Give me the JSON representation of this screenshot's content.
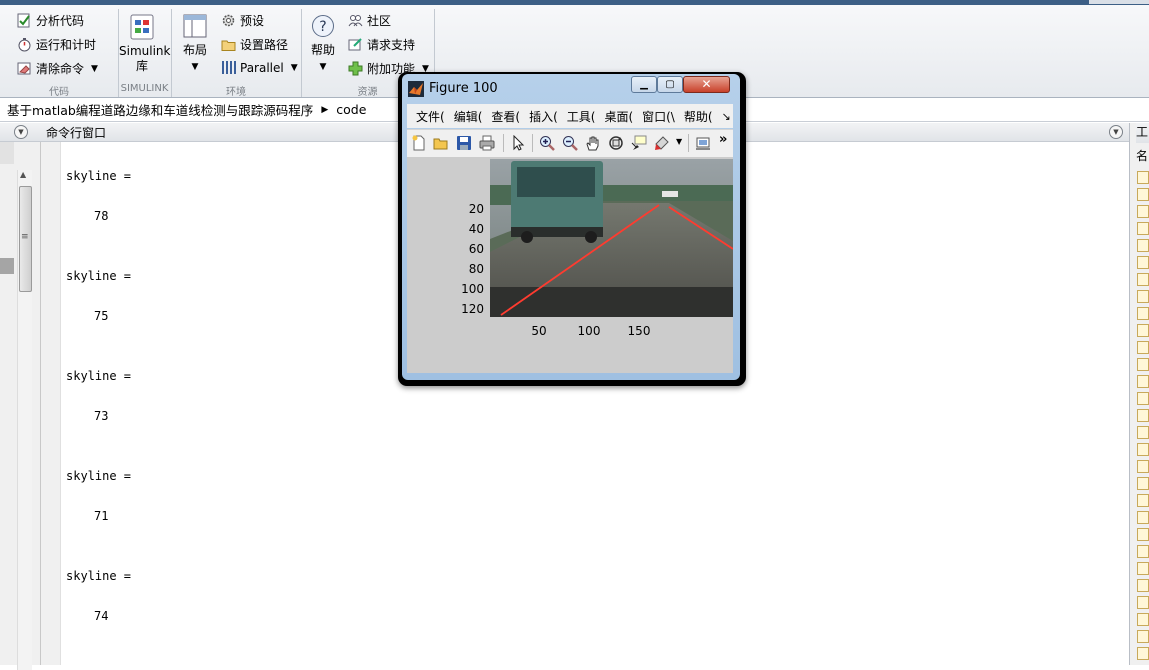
{
  "ribbon": {
    "code_group": {
      "items": [
        "分析代码",
        "运行和计时",
        "清除命令"
      ],
      "label": "代码"
    },
    "simulink_group": {
      "button": [
        "Simulink",
        "库"
      ],
      "label": "SIMULINK"
    },
    "env_group": {
      "layout_label": "布局",
      "items": [
        "预设",
        "设置路径",
        "Parallel"
      ],
      "label": "环境"
    },
    "resources_group": {
      "help_label": "帮助",
      "items": [
        "社区",
        "请求支持",
        "附加功能"
      ],
      "label": "资源"
    }
  },
  "address": {
    "path": [
      "基于matlab编程道路边缘和车道线检测与跟踪源码程序",
      "code"
    ]
  },
  "command_window": {
    "title": "命令行窗口",
    "output": [
      {
        "name": "skyline =",
        "value": "78"
      },
      {
        "name": "skyline =",
        "value": "75"
      },
      {
        "name": "skyline =",
        "value": "73"
      },
      {
        "name": "skyline =",
        "value": "71"
      },
      {
        "name": "skyline =",
        "value": "74"
      }
    ]
  },
  "right_panel": {
    "header": "工",
    "sub": "名"
  },
  "figure": {
    "title": "Figure 100",
    "menu": [
      "文件(",
      "编辑(",
      "查看(",
      "插入(",
      "工具(",
      "桌面(",
      "窗口(\\",
      "帮助(",
      "↘"
    ],
    "toolbar_more": "»",
    "y_ticks": [
      "20",
      "40",
      "60",
      "80",
      "100",
      "120"
    ],
    "x_ticks": [
      "50",
      "100",
      "150"
    ]
  },
  "colors": {
    "accent": "#3c5f86",
    "lane_line": "#ff3b2f"
  },
  "icons": [
    "new-file-icon",
    "open-folder-icon",
    "save-icon",
    "print-icon",
    "pointer-icon",
    "zoom-in-icon",
    "zoom-out-icon",
    "pan-hand-icon",
    "rotate-3d-icon",
    "data-cursor-icon",
    "brush-icon",
    "link-plot-icon"
  ]
}
